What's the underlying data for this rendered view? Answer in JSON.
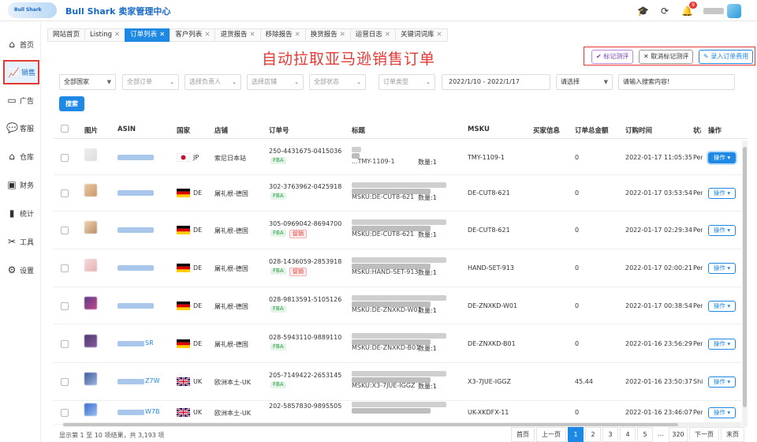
{
  "app": {
    "logo_text": "Bull Shark",
    "title": "Bull Shark 卖家管理中心",
    "notification_count": "9"
  },
  "sidebar": {
    "items": [
      {
        "label": "首页",
        "icon": "home-icon"
      },
      {
        "label": "销售",
        "icon": "chart-line-icon",
        "active": true
      },
      {
        "label": "广告",
        "icon": "ad-icon"
      },
      {
        "label": "客服",
        "icon": "chat-icon"
      },
      {
        "label": "仓库",
        "icon": "warehouse-icon"
      },
      {
        "label": "财务",
        "icon": "finance-icon"
      },
      {
        "label": "统计",
        "icon": "bar-chart-icon"
      },
      {
        "label": "工具",
        "icon": "tools-icon"
      },
      {
        "label": "设置",
        "icon": "settings-icon"
      }
    ]
  },
  "tabs": [
    {
      "label": "网站首页",
      "closable": false
    },
    {
      "label": "Listing",
      "closable": true
    },
    {
      "label": "订单列表",
      "closable": true,
      "active": true
    },
    {
      "label": "客户列表",
      "closable": true
    },
    {
      "label": "退货报告",
      "closable": true
    },
    {
      "label": "移除报告",
      "closable": true
    },
    {
      "label": "换货报告",
      "closable": true
    },
    {
      "label": "运营日志",
      "closable": true
    },
    {
      "label": "关键词词库",
      "closable": true
    }
  ],
  "headline": "自动拉取亚马逊销售订单",
  "actions": {
    "mark": "✔ 标记测评",
    "unmark": "✕ 取消标记测评",
    "fee": "✎ 录入订单费用"
  },
  "filters": {
    "country": "全部国家",
    "order": "全部订单",
    "owner": "选择负责人",
    "store": "选择店铺",
    "status": "全部状态",
    "order_type": "订单类型",
    "date_range": "2022/1/10 - 2022/1/17",
    "select": "请选择",
    "search_placeholder": "请输入搜索内容!",
    "search_button": "搜索"
  },
  "table": {
    "headers": [
      "图片",
      "ASIN",
      "国家",
      "店铺",
      "订单号",
      "标题",
      "MSKU",
      "买家信息",
      "订单总金额",
      "订购时间",
      "状态",
      "操作"
    ],
    "rows": [
      {
        "asin_suffix": "",
        "country": "JP",
        "store": "索尼日本站",
        "order_no": "250-4431675-0415036",
        "tags": [
          "FBA"
        ],
        "title_sub": "...TMY-1109-1",
        "qty": "数量:1",
        "msku": "TMY-1109-1",
        "amount": "0",
        "time": "2022-01-17 11:05:35",
        "status": "Pen",
        "op": "操作"
      },
      {
        "asin_suffix": "",
        "country": "DE",
        "store": "屠礼根-德国",
        "order_no": "302-3763962-0425918",
        "tags": [
          "FBA"
        ],
        "title_sub": "MSKU:DE-CUT8-621",
        "qty": "数量:1",
        "msku": "DE-CUT8-621",
        "amount": "0",
        "time": "2022-01-17 03:53:54",
        "status": "Pen",
        "op": "操作"
      },
      {
        "asin_suffix": "",
        "country": "DE",
        "store": "屠礼根-德国",
        "order_no": "305-0969042-8694700",
        "tags": [
          "FBA",
          "促销"
        ],
        "title_sub": "MSKU:DE-CUT8-621",
        "qty": "数量:1",
        "msku": "DE-CUT8-621",
        "amount": "0",
        "time": "2022-01-17 02:29:34",
        "status": "Pen",
        "op": "操作"
      },
      {
        "asin_suffix": "",
        "country": "DE",
        "store": "屠礼根-德国",
        "order_no": "028-1436059-2853918",
        "tags": [
          "FBA",
          "促销"
        ],
        "title_sub": "MSKU:HAND-SET-913",
        "qty": "数量:1",
        "msku": "HAND-SET-913",
        "amount": "0",
        "time": "2022-01-17 02:00:21",
        "status": "Pen",
        "op": "操作"
      },
      {
        "asin_suffix": "",
        "country": "DE",
        "store": "屠礼根-德国",
        "order_no": "028-9813591-5105126",
        "tags": [
          "FBA"
        ],
        "title_sub": "MSKU:DE-ZNXKD-W01",
        "qty": "数量:1",
        "msku": "DE-ZNXKD-W01",
        "amount": "0",
        "time": "2022-01-17 00:38:54",
        "status": "Pen",
        "op": "操作"
      },
      {
        "asin_suffix": "SR",
        "country": "DE",
        "store": "屠礼根-德国",
        "order_no": "028-5943110-9889110",
        "tags": [
          "FBA"
        ],
        "title_sub": "MSKU:DE-ZNXKD-B01",
        "qty": "数量:1",
        "msku": "DE-ZNXKD-B01",
        "amount": "0",
        "time": "2022-01-16 23:56:29",
        "status": "Pen",
        "op": "操作"
      },
      {
        "asin_suffix": "Z7W",
        "country": "UK",
        "store": "欧洲本土-UK",
        "order_no": "205-7149422-2653145",
        "tags": [
          "FBA"
        ],
        "title_sub": "MSKU:X3-7JUE-IGGZ",
        "qty": "数量:1",
        "msku": "X3-7JUE-IGGZ",
        "amount": "45.44",
        "time": "2022-01-16 23:50:37",
        "status": "Shi",
        "op": "操作"
      },
      {
        "asin_suffix": "W7B",
        "country": "UK",
        "store": "欧洲本土-UK",
        "order_no": "202-5857830-9895505",
        "tags": [],
        "title_sub": "",
        "qty": "",
        "msku": "UK-XKDFX-11",
        "amount": "0",
        "time": "2022-01-16 23:46:07",
        "status": "Pen",
        "op": "操作"
      }
    ]
  },
  "pagination": {
    "summary": "显示第 1 至 10 项结果，共 3,193 项",
    "first": "首页",
    "prev": "上一页",
    "pages": [
      "1",
      "2",
      "3",
      "4",
      "5",
      "...",
      "320"
    ],
    "next": "下一页",
    "last": "末页"
  },
  "colors": {
    "accent": "#1e88e5",
    "highlight": "#e53935",
    "fba": "#2e9b46"
  }
}
